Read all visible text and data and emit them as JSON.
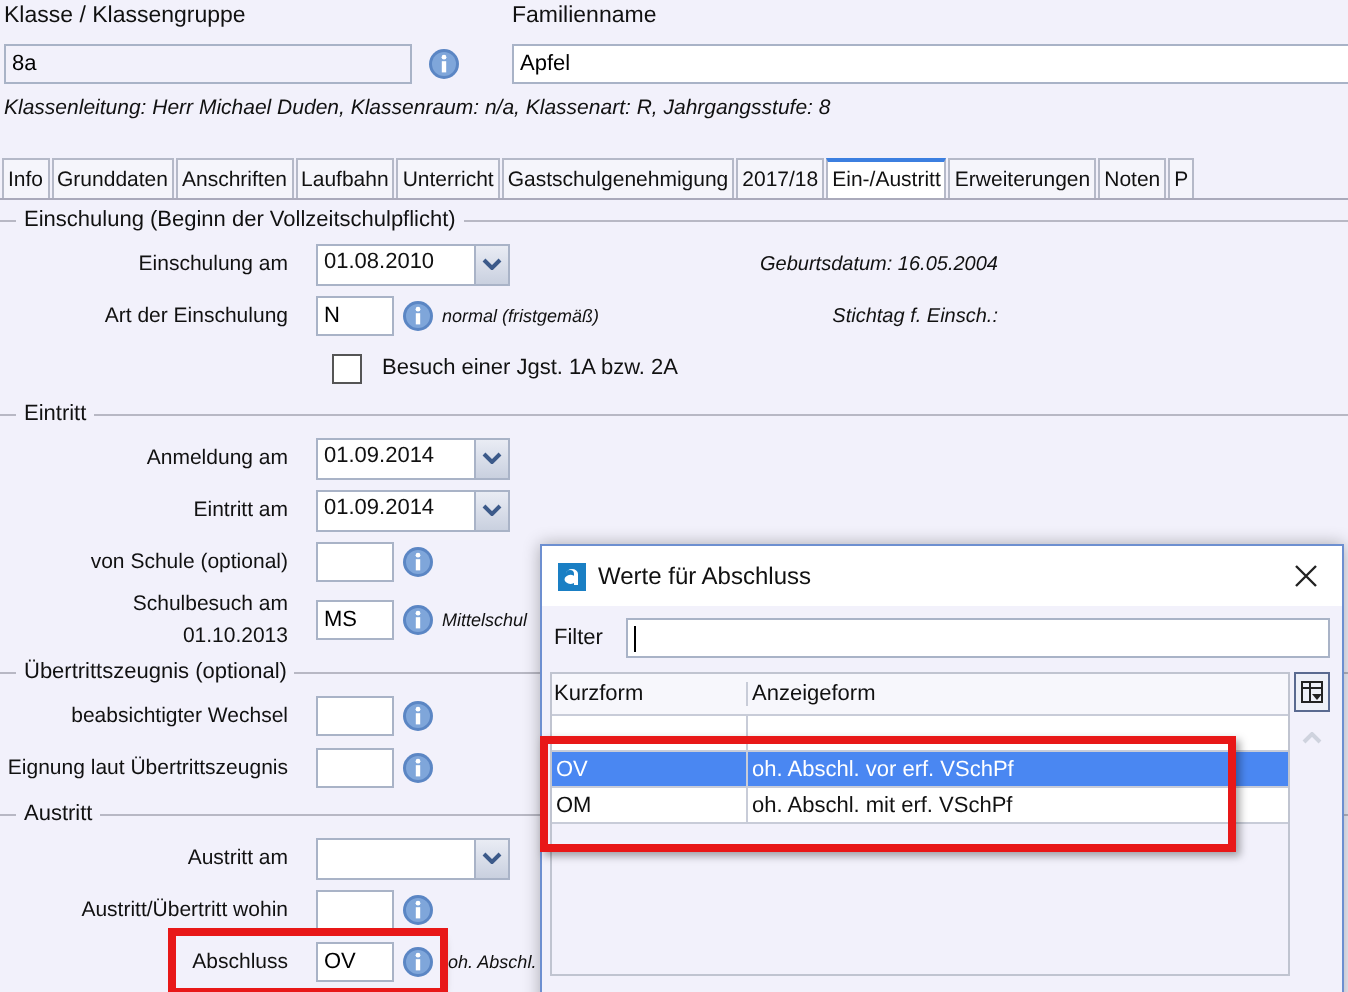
{
  "header": {
    "class_label": "Klasse / Klassengruppe",
    "class_value": "8a",
    "family_label": "Familienname",
    "family_value": "Apfel",
    "info": "Klassenleitung: Herr Michael Duden, Klassenraum: n/a, Klassenart: R, Jahrgangsstufe: 8"
  },
  "tabs": [
    {
      "label": "Info",
      "selected": false
    },
    {
      "label": "Grunddaten",
      "selected": false
    },
    {
      "label": "Anschriften",
      "selected": false
    },
    {
      "label": "Laufbahn",
      "selected": false
    },
    {
      "label": "Unterricht",
      "selected": false
    },
    {
      "label": "Gastschulgenehmigung",
      "selected": false
    },
    {
      "label": "2017/18",
      "selected": false
    },
    {
      "label": "Ein-/Austritt",
      "selected": true
    },
    {
      "label": "Erweiterungen",
      "selected": false
    },
    {
      "label": "Noten",
      "selected": false
    },
    {
      "label": "P",
      "selected": false
    }
  ],
  "sections": [
    {
      "title": "Einschulung (Beginn der Vollzeitschulpflicht)",
      "rows": [
        {
          "kind": "date",
          "label": "Einschulung am",
          "value": "01.08.2010",
          "aside": "Geburtsdatum: 16.05.2004"
        },
        {
          "kind": "code",
          "label": "Art der Einschulung",
          "value": "N",
          "note": "normal (fristgemäß)",
          "aside": "Stichtag f. Einsch.:"
        },
        {
          "kind": "checkbox",
          "label": "Besuch einer Jgst. 1A bzw. 2A",
          "checked": false
        }
      ]
    },
    {
      "title": "Eintritt",
      "rows": [
        {
          "kind": "date",
          "label": "Anmeldung am",
          "value": "01.09.2014"
        },
        {
          "kind": "date",
          "label": "Eintritt am",
          "value": "01.09.2014"
        },
        {
          "kind": "code",
          "label": "von Schule (optional)"
        },
        {
          "kind": "code",
          "label": "Schulbesuch am",
          "sublabel": "01.10.2013",
          "value": "MS",
          "note": "Mittelschul"
        }
      ]
    },
    {
      "title": "Übertrittszeugnis (optional)",
      "rows": [
        {
          "kind": "code",
          "label": "beabsichtigter Wechsel"
        },
        {
          "kind": "code",
          "label": "Eignung laut Übertrittszeugnis"
        }
      ]
    },
    {
      "title": "Austritt",
      "rows": [
        {
          "kind": "date",
          "label": "Austritt am"
        },
        {
          "kind": "code",
          "label": "Austritt/Übertritt wohin"
        },
        {
          "kind": "code",
          "label": "Abschluss",
          "value": "OV",
          "note": "oh. Abschl.",
          "highlighted": true
        }
      ]
    }
  ],
  "dialog": {
    "title": "Werte für Abschluss",
    "filter_label": "Filter",
    "columns": [
      "Kurzform",
      "Anzeigeform"
    ],
    "rows": [
      {
        "cells": [
          "",
          ""
        ],
        "selected": false,
        "highlighted": false
      },
      {
        "cells": [
          "OV",
          "oh. Abschl. vor erf. VSchPf"
        ],
        "selected": true,
        "highlighted": true
      },
      {
        "cells": [
          "OM",
          "oh. Abschl. mit erf. VSchPf"
        ],
        "selected": false,
        "highlighted": true
      }
    ]
  }
}
